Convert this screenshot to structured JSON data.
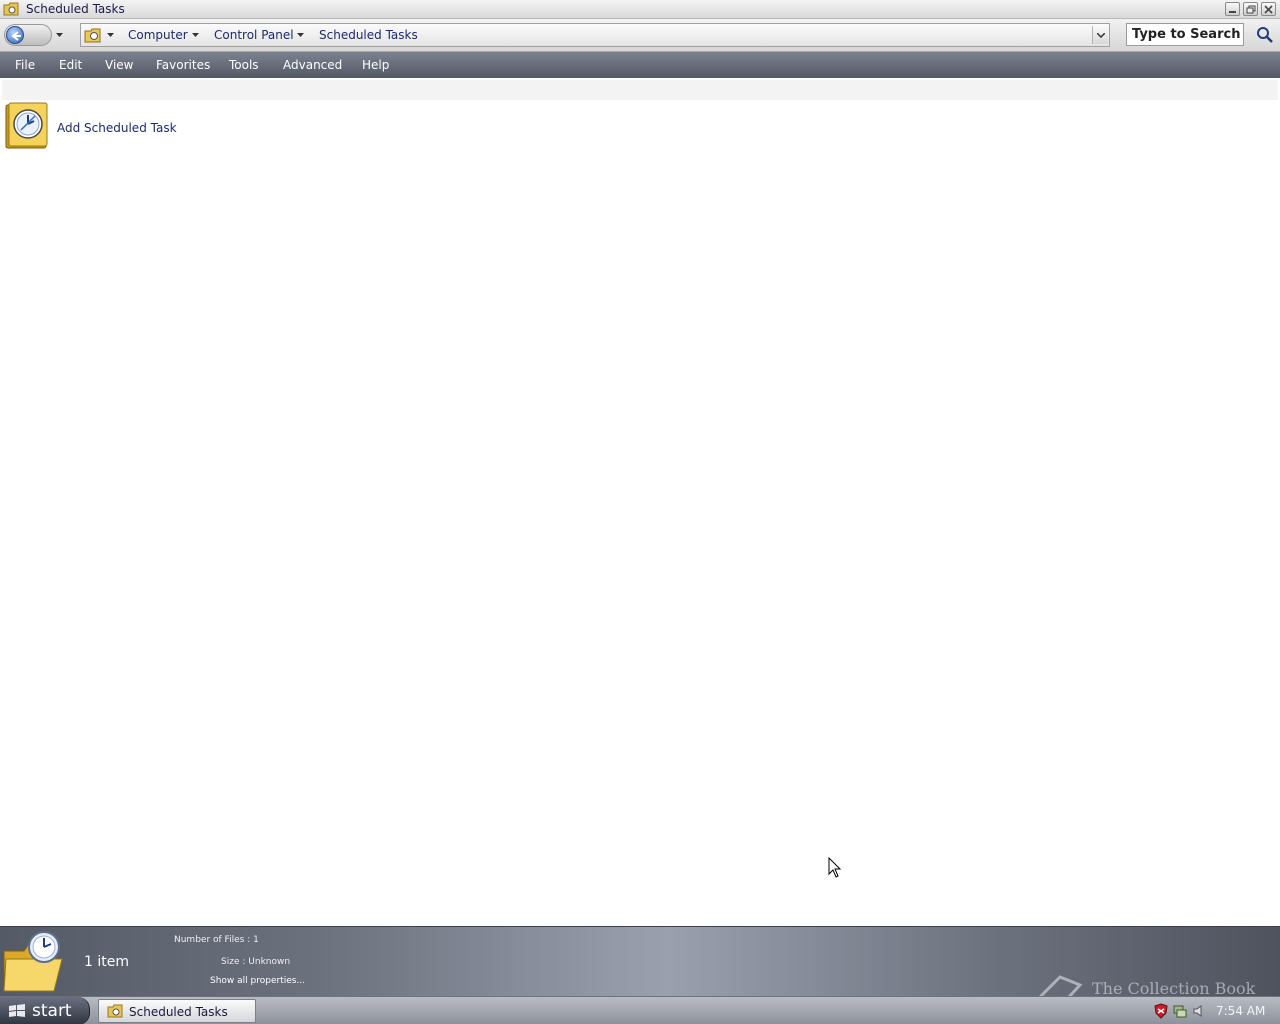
{
  "window": {
    "title": "Scheduled Tasks",
    "icon": "scheduled-tasks-folder-icon"
  },
  "addressbar": {
    "crumbs": [
      "Computer",
      "Control Panel",
      "Scheduled Tasks"
    ],
    "search_placeholder": "Type to Search"
  },
  "menu": {
    "items": [
      "File",
      "Edit",
      "View",
      "Favorites",
      "Tools",
      "Advanced",
      "Help"
    ]
  },
  "content": {
    "items": [
      {
        "label": "Add Scheduled Task",
        "icon": "add-scheduled-task-icon"
      }
    ]
  },
  "details": {
    "count": "1 item",
    "properties": [
      {
        "key": "Number of Files",
        "value": "1"
      },
      {
        "key": "Size",
        "value": "Unknown"
      }
    ],
    "show_all": "Show all properties...",
    "watermark": "The Collection Book"
  },
  "taskbar": {
    "start_label": "start",
    "task_button": "Scheduled Tasks",
    "clock": "7:54 AM"
  },
  "colors": {
    "menubar": "#5f6471",
    "link_text": "#1e2a6a",
    "details_bg": "#7a7f8c"
  }
}
